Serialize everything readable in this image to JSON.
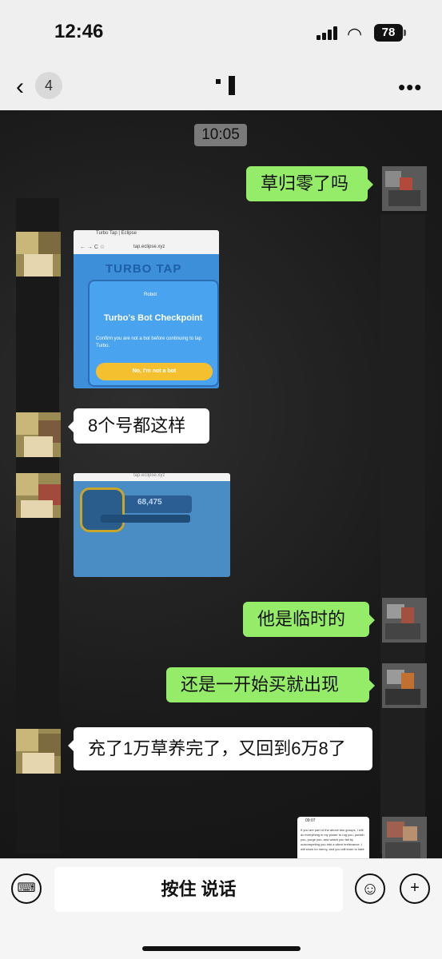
{
  "status_bar": {
    "time": "12:46",
    "battery": "78"
  },
  "nav": {
    "back_glyph": "‹",
    "unread_count": "4",
    "more_glyph": "•••"
  },
  "chat": {
    "timestamp": "10:05",
    "messages": [
      {
        "side": "right",
        "text": "草归零了吗"
      },
      {
        "side": "left",
        "type": "image",
        "image_id": "checkpoint"
      },
      {
        "side": "left",
        "text": "8个号都这样"
      },
      {
        "side": "left",
        "type": "image",
        "image_id": "balance"
      },
      {
        "side": "right",
        "text": "他是临时的"
      },
      {
        "side": "right",
        "text": "还是一开始买就出现"
      },
      {
        "side": "left",
        "text": "充了1万草养完了，又回到6万8了"
      },
      {
        "side": "right",
        "type": "image",
        "image_id": "notice"
      }
    ]
  },
  "images": {
    "checkpoint": {
      "tab_title": "Turbo Tap | Eclipse",
      "nav": "←  →  C  ☆",
      "url": "tap.eclipse.xyz",
      "logo": "TURBO TAP",
      "robot_label": "Robot",
      "card_title": "Turbo's Bot Checkpoint",
      "card_desc": "Confirm you are not a bot before continuing to tap Turbo.",
      "button": "No, I'm not a bot"
    },
    "balance": {
      "url": "tap.eclipse.xyz",
      "value": "68,475"
    },
    "notice": {
      "time": "09:07",
      "text": "If you are part of the above two groups, I will do everything in my power to rug you, punish you, purge you, and watch you fall by outcompeting you into a silent irrelevance. I will show no mercy, and you will learn to hate"
    }
  },
  "input_bar": {
    "hold_to_talk": "按住 说话",
    "keyboard_icon": "keyboard-icon",
    "emoji_icon": "emoji-icon"
  },
  "colors": {
    "sent_bubble": "#95ec69",
    "received_bubble": "#ffffff"
  }
}
